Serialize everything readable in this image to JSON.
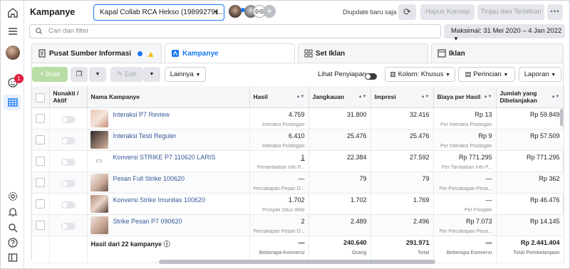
{
  "header": {
    "title": "Kampanye",
    "account": "Kapal Collab RCA Hekso (198992791...",
    "update_status": "Diupdate baru saja",
    "discard_label": "Hapus Konsep",
    "review_label": "Tinjau dan Terbitkan"
  },
  "search": {
    "placeholder": "Cari dan filter"
  },
  "date_range": "Maksimal: 31 Mei 2020 – 4 Jan 2022",
  "rail": {
    "badge": "1"
  },
  "tabs": [
    {
      "label": "Pusat Sumber Informasi"
    },
    {
      "label": "Kampanye"
    },
    {
      "label": "Set Iklan"
    },
    {
      "label": "Iklan"
    }
  ],
  "toolbar": {
    "create_label": "+ Buat",
    "edit_label": "Edit",
    "more_label": "Lainnya",
    "show_drafts_label": "Lihat Penyiapan",
    "columns_label": "Kolom: Khusus",
    "breakdown_label": "Perincian",
    "reports_label": "Laporan"
  },
  "columns": {
    "toggle": "Nonakti / Aktif",
    "name": "Nama Kampanye",
    "results": "Hasil",
    "reach": "Jangkauan",
    "impressions": "Impresi",
    "cost": "Biaya per Hasil",
    "spent": "Jumlah yang Dibelanjakan"
  },
  "rows": [
    {
      "name": "Interaksi P7 Review",
      "results": "4.759",
      "results_sub": "Interaksi Postingan",
      "reach": "31.800",
      "impressions": "32.416",
      "cost": "Rp 13",
      "cost_sub": "Per Interaksi Postingan",
      "spent": "Rp 59.849"
    },
    {
      "name": "Interaksi Testi Reguler",
      "results": "6.410",
      "results_sub": "Interaksi Postingan",
      "reach": "25.476",
      "impressions": "25.476",
      "cost": "Rp 9",
      "cost_sub": "Per Interaksi Postingan",
      "spent": "Rp 57.509"
    },
    {
      "name": "Konversi STRIKE P7 110620 LARIS",
      "results": "1",
      "results_sub": "Penambahan Info P...",
      "reach": "22.384",
      "impressions": "27.592",
      "cost": "Rp 771.295",
      "cost_sub": "Per Tambahan Info P...",
      "spent": "Rp 771.295"
    },
    {
      "name": "Pesan Full Strike 100620",
      "results": "—",
      "results_sub": "Percakapan Pesan D...",
      "reach": "79",
      "impressions": "79",
      "cost": "—",
      "cost_sub": "Per Percakapan Pesa...",
      "spent": "Rp 362"
    },
    {
      "name": "Konversi Strike Imunitas 100620",
      "results": "1.702",
      "results_sub": "Prospek Situs Web",
      "reach": "1.702",
      "impressions": "1.769",
      "cost": "—",
      "cost_sub": "Per Prospek",
      "spent": "Rp 46.476"
    },
    {
      "name": "Strike Pesan P7 090620",
      "results": "2",
      "results_sub": "Percakapan Pesan D...",
      "reach": "2.489",
      "impressions": "2.496",
      "cost": "Rp 7.073",
      "cost_sub": "Per Percakapan Pesa...",
      "spent": "Rp 14.145"
    }
  ],
  "footer": {
    "label": "Hasil dari 22 kampanye",
    "results": "—",
    "results_sub": "Beberapa Konversi",
    "reach": "240.640",
    "reach_sub": "Orang",
    "impressions": "291.971",
    "impressions_sub": "Total",
    "cost": "—",
    "cost_sub": "Beberapa Konversi",
    "spent": "Rp 2.441.404",
    "spent_sub": "Total Pembelanjaan"
  }
}
